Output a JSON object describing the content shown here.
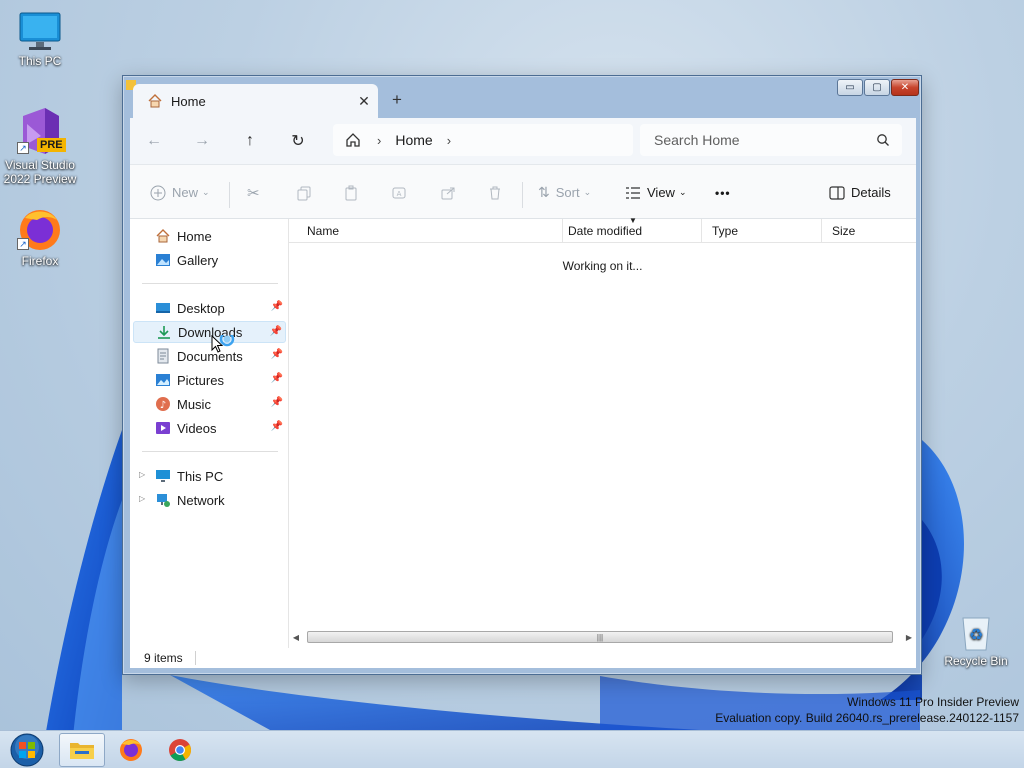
{
  "desktop": {
    "icons": [
      {
        "label": "This PC"
      },
      {
        "label": "Visual Studio 2022 Preview",
        "badge": "PRE"
      },
      {
        "label": "Firefox"
      },
      {
        "label": "Recycle Bin"
      }
    ],
    "watermark": {
      "line1": "Windows 11 Pro Insider Preview",
      "line2": "Evaluation copy. Build 26040.rs_prerelease.240122-1157"
    }
  },
  "window": {
    "tab": {
      "title": "Home",
      "close_glyph": "✕"
    },
    "new_tab_glyph": "+",
    "controls": {
      "minimize": "▭",
      "maximize": "▢",
      "close": "✕"
    },
    "nav": {
      "back": "←",
      "forward": "→",
      "up": "↑",
      "refresh": "↻"
    },
    "breadcrumb": {
      "items": [
        "Home"
      ],
      "separator": "›"
    },
    "search": {
      "placeholder": "Search Home"
    },
    "commands": {
      "new": "New",
      "sort": "Sort",
      "view": "View",
      "more": "•••",
      "details": "Details"
    },
    "sidebar": {
      "quick": [
        {
          "label": "Home",
          "icon": "home-icon"
        },
        {
          "label": "Gallery",
          "icon": "gallery-icon"
        }
      ],
      "pinned": [
        {
          "label": "Desktop",
          "icon": "desktop-folder-icon"
        },
        {
          "label": "Downloads",
          "icon": "downloads-icon"
        },
        {
          "label": "Documents",
          "icon": "documents-icon"
        },
        {
          "label": "Pictures",
          "icon": "pictures-icon"
        },
        {
          "label": "Music",
          "icon": "music-icon"
        },
        {
          "label": "Videos",
          "icon": "videos-icon"
        }
      ],
      "locations": [
        {
          "label": "This PC",
          "icon": "this-pc-icon"
        },
        {
          "label": "Network",
          "icon": "network-icon"
        }
      ]
    },
    "columns": [
      "Name",
      "Date modified",
      "Type",
      "Size"
    ],
    "content_message": "Working on it...",
    "status": {
      "item_count": "9 items"
    }
  },
  "colors": {
    "accent": "#0067c0",
    "window_frame": "#a4bedc"
  }
}
